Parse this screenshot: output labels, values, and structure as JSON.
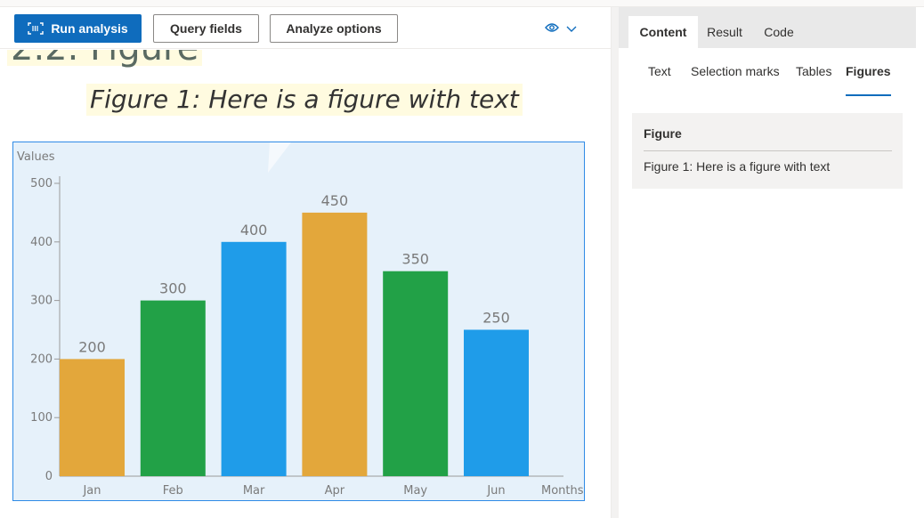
{
  "toolbar": {
    "run_label": "Run analysis",
    "query_label": "Query fields",
    "analyze_label": "Analyze options"
  },
  "document": {
    "heading_fragment": "2.2. Figure",
    "figure_caption": "Figure 1: Here is a figure with text"
  },
  "chart_data": {
    "type": "bar",
    "title": "",
    "xlabel": "Months",
    "ylabel": "Values",
    "categories": [
      "Jan",
      "Feb",
      "Mar",
      "Apr",
      "May",
      "Jun"
    ],
    "values": [
      200,
      300,
      400,
      450,
      350,
      250
    ],
    "data_labels": [
      "200",
      "300",
      "400",
      "450",
      "350",
      "250"
    ],
    "bar_colors": [
      "#e3a73b",
      "#22a147",
      "#1f9ce9",
      "#e3a73b",
      "#22a147",
      "#1f9ce9"
    ],
    "yticks": [
      "0",
      "100",
      "200",
      "300",
      "400",
      "500"
    ],
    "ylim": [
      0,
      500
    ],
    "grid": false,
    "legend": "none"
  },
  "right_pane": {
    "tabs": [
      "Content",
      "Result",
      "Code"
    ],
    "subtabs": [
      "Text",
      "Selection marks",
      "Tables",
      "Figures"
    ],
    "figure_card": {
      "title": "Figure",
      "text": "Figure 1: Here is a figure with text"
    }
  },
  "colors": {
    "accent": "#0f6cbd",
    "chart_background": "#e6f1fa",
    "highlight": "#fffbe0"
  }
}
